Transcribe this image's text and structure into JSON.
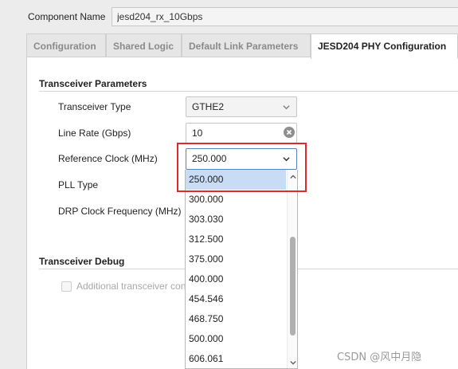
{
  "component": {
    "label": "Component Name",
    "value": "jesd204_rx_10Gbps"
  },
  "tabs": [
    {
      "label": "Configuration",
      "active": false
    },
    {
      "label": "Shared Logic",
      "active": false
    },
    {
      "label": "Default Link Parameters",
      "active": false
    },
    {
      "label": "JESD204 PHY Configuration",
      "active": true
    }
  ],
  "transceiver_parameters": {
    "title": "Transceiver Parameters",
    "transceiver_type": {
      "label": "Transceiver Type",
      "value": "GTHE2"
    },
    "line_rate": {
      "label": "Line Rate (Gbps)",
      "value": "10"
    },
    "reference_clock": {
      "label": "Reference Clock (MHz)",
      "value": "250.000",
      "options": [
        "250.000",
        "300.000",
        "303.030",
        "312.500",
        "375.000",
        "400.000",
        "454.546",
        "468.750",
        "500.000",
        "606.061"
      ],
      "selected_index": 0
    },
    "pll_type": {
      "label": "PLL Type"
    },
    "drp_clock": {
      "label": "DRP Clock Frequency (MHz)"
    }
  },
  "transceiver_debug": {
    "title": "Transceiver Debug",
    "checkbox_label": "Additional transceiver control and status ports",
    "checked": false
  },
  "watermark": "CSDN @风中月隐",
  "colors": {
    "highlight": "#e0282e",
    "selected_option": "#c9dcf5",
    "focus_border": "#5a7fc8"
  },
  "icons": {
    "combo": "chevron-down-icon",
    "clear": "clear-circle-icon",
    "scroll_up": "chevron-up-icon",
    "scroll_down": "chevron-down-icon"
  }
}
